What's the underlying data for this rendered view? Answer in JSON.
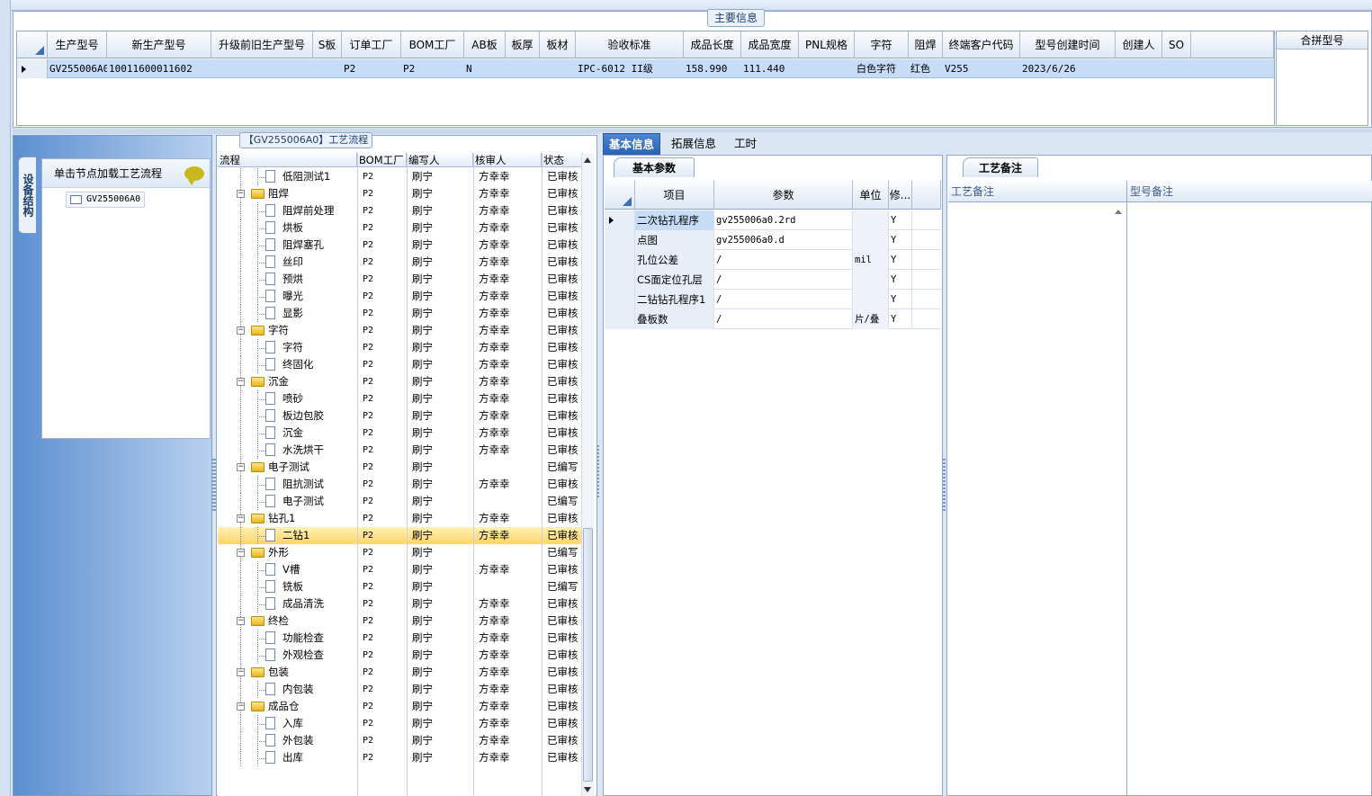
{
  "main_info": {
    "group_title": "主要信息",
    "columns": [
      "生产型号",
      "新生产型号",
      "升级前旧生产型号",
      "S板",
      "订单工厂",
      "BOM工厂",
      "AB板",
      "板厚",
      "板材",
      "验收标准",
      "成品长度",
      "成品宽度",
      "PNL规格",
      "字符",
      "阻焊",
      "终端客户代码",
      "型号创建时间",
      "创建人",
      "SO"
    ],
    "row": [
      "GV255006A0",
      "10011600011602",
      "",
      "",
      "P2",
      "P2",
      "N",
      "",
      "",
      "IPC-6012 II级",
      "158.990",
      "111.440",
      "",
      "白色字符",
      "红色",
      "V255",
      "2023/6/26",
      "",
      ""
    ],
    "merge_label": "合拼型号"
  },
  "left_panel": {
    "vertical_tab": "设备结构",
    "head_label": "单击节点加载工艺流程",
    "node_label": "GV255006A0"
  },
  "process": {
    "title": "【GV255006A0】工艺流程",
    "headers": [
      "流程",
      "BOM工厂",
      "编写人",
      "核审人",
      "状态"
    ],
    "rows": [
      {
        "name": "低阻测试1",
        "level": 1,
        "type": "doc",
        "bom": "P2",
        "writer": "刷宁",
        "reviewer": "方幸幸",
        "status": "已审核",
        "selected": false
      },
      {
        "name": "阻焊",
        "level": 0,
        "type": "folder",
        "bom": "P2",
        "writer": "刷宁",
        "reviewer": "方幸幸",
        "status": "已审核",
        "selected": false
      },
      {
        "name": "阻焊前处理",
        "level": 1,
        "type": "doc",
        "bom": "P2",
        "writer": "刷宁",
        "reviewer": "方幸幸",
        "status": "已审核",
        "selected": false
      },
      {
        "name": "烘板",
        "level": 1,
        "type": "doc",
        "bom": "P2",
        "writer": "刷宁",
        "reviewer": "方幸幸",
        "status": "已审核",
        "selected": false
      },
      {
        "name": "阻焊塞孔",
        "level": 1,
        "type": "doc",
        "bom": "P2",
        "writer": "刷宁",
        "reviewer": "方幸幸",
        "status": "已审核",
        "selected": false
      },
      {
        "name": "丝印",
        "level": 1,
        "type": "doc",
        "bom": "P2",
        "writer": "刷宁",
        "reviewer": "方幸幸",
        "status": "已审核",
        "selected": false
      },
      {
        "name": "预烘",
        "level": 1,
        "type": "doc",
        "bom": "P2",
        "writer": "刷宁",
        "reviewer": "方幸幸",
        "status": "已审核",
        "selected": false
      },
      {
        "name": "曝光",
        "level": 1,
        "type": "doc",
        "bom": "P2",
        "writer": "刷宁",
        "reviewer": "方幸幸",
        "status": "已审核",
        "selected": false
      },
      {
        "name": "显影",
        "level": 1,
        "type": "doc",
        "bom": "P2",
        "writer": "刷宁",
        "reviewer": "方幸幸",
        "status": "已审核",
        "selected": false
      },
      {
        "name": "字符",
        "level": 0,
        "type": "folder",
        "bom": "P2",
        "writer": "刷宁",
        "reviewer": "方幸幸",
        "status": "已审核",
        "selected": false
      },
      {
        "name": "字符",
        "level": 1,
        "type": "doc",
        "bom": "P2",
        "writer": "刷宁",
        "reviewer": "方幸幸",
        "status": "已审核",
        "selected": false
      },
      {
        "name": "终固化",
        "level": 1,
        "type": "doc",
        "bom": "P2",
        "writer": "刷宁",
        "reviewer": "方幸幸",
        "status": "已审核",
        "selected": false
      },
      {
        "name": "沉金",
        "level": 0,
        "type": "folder",
        "bom": "P2",
        "writer": "刷宁",
        "reviewer": "方幸幸",
        "status": "已审核",
        "selected": false
      },
      {
        "name": "喷砂",
        "level": 1,
        "type": "doc",
        "bom": "P2",
        "writer": "刷宁",
        "reviewer": "方幸幸",
        "status": "已审核",
        "selected": false
      },
      {
        "name": "板边包胶",
        "level": 1,
        "type": "doc",
        "bom": "P2",
        "writer": "刷宁",
        "reviewer": "方幸幸",
        "status": "已审核",
        "selected": false
      },
      {
        "name": "沉金",
        "level": 1,
        "type": "doc",
        "bom": "P2",
        "writer": "刷宁",
        "reviewer": "方幸幸",
        "status": "已审核",
        "selected": false
      },
      {
        "name": "水洗烘干",
        "level": 1,
        "type": "doc",
        "bom": "P2",
        "writer": "刷宁",
        "reviewer": "方幸幸",
        "status": "已审核",
        "selected": false
      },
      {
        "name": "电子测试",
        "level": 0,
        "type": "folder",
        "bom": "P2",
        "writer": "刷宁",
        "reviewer": "",
        "status": "已编写",
        "selected": false
      },
      {
        "name": "阻抗测试",
        "level": 1,
        "type": "doc",
        "bom": "P2",
        "writer": "刷宁",
        "reviewer": "方幸幸",
        "status": "已审核",
        "selected": false
      },
      {
        "name": "电子测试",
        "level": 1,
        "type": "doc",
        "bom": "P2",
        "writer": "刷宁",
        "reviewer": "",
        "status": "已编写",
        "selected": false
      },
      {
        "name": "钻孔1",
        "level": 0,
        "type": "folder",
        "bom": "P2",
        "writer": "刷宁",
        "reviewer": "方幸幸",
        "status": "已审核",
        "selected": false
      },
      {
        "name": "二钻1",
        "level": 1,
        "type": "doc",
        "bom": "P2",
        "writer": "刷宁",
        "reviewer": "方幸幸",
        "status": "已审核",
        "selected": true
      },
      {
        "name": "外形",
        "level": 0,
        "type": "folder",
        "bom": "P2",
        "writer": "刷宁",
        "reviewer": "",
        "status": "已编写",
        "selected": false
      },
      {
        "name": "V槽",
        "level": 1,
        "type": "doc",
        "bom": "P2",
        "writer": "刷宁",
        "reviewer": "方幸幸",
        "status": "已审核",
        "selected": false
      },
      {
        "name": "铣板",
        "level": 1,
        "type": "doc",
        "bom": "P2",
        "writer": "刷宁",
        "reviewer": "",
        "status": "已编写",
        "selected": false
      },
      {
        "name": "成品清洗",
        "level": 1,
        "type": "doc",
        "bom": "P2",
        "writer": "刷宁",
        "reviewer": "方幸幸",
        "status": "已审核",
        "selected": false
      },
      {
        "name": "终检",
        "level": 0,
        "type": "folder",
        "bom": "P2",
        "writer": "刷宁",
        "reviewer": "方幸幸",
        "status": "已审核",
        "selected": false
      },
      {
        "name": "功能检查",
        "level": 1,
        "type": "doc",
        "bom": "P2",
        "writer": "刷宁",
        "reviewer": "方幸幸",
        "status": "已审核",
        "selected": false
      },
      {
        "name": "外观检查",
        "level": 1,
        "type": "doc",
        "bom": "P2",
        "writer": "刷宁",
        "reviewer": "方幸幸",
        "status": "已审核",
        "selected": false
      },
      {
        "name": "包装",
        "level": 0,
        "type": "folder",
        "bom": "P2",
        "writer": "刷宁",
        "reviewer": "方幸幸",
        "status": "已审核",
        "selected": false
      },
      {
        "name": "内包装",
        "level": 1,
        "type": "doc",
        "bom": "P2",
        "writer": "刷宁",
        "reviewer": "方幸幸",
        "status": "已审核",
        "selected": false
      },
      {
        "name": "成品仓",
        "level": 0,
        "type": "folder",
        "bom": "P2",
        "writer": "刷宁",
        "reviewer": "方幸幸",
        "status": "已审核",
        "selected": false
      },
      {
        "name": "入库",
        "level": 1,
        "type": "doc",
        "bom": "P2",
        "writer": "刷宁",
        "reviewer": "方幸幸",
        "status": "已审核",
        "selected": false
      },
      {
        "name": "外包装",
        "level": 1,
        "type": "doc",
        "bom": "P2",
        "writer": "刷宁",
        "reviewer": "方幸幸",
        "status": "已审核",
        "selected": false
      },
      {
        "name": "出库",
        "level": 1,
        "type": "doc",
        "bom": "P2",
        "writer": "刷宁",
        "reviewer": "方幸幸",
        "status": "已审核",
        "selected": false
      }
    ]
  },
  "tabs": [
    "基本信息",
    "拓展信息",
    "工时"
  ],
  "basic_params": {
    "tab_label": "基本参数",
    "headers": [
      "项目",
      "参数",
      "单位",
      "修..."
    ],
    "rows": [
      {
        "item": "二次钻孔程序",
        "param": "gv255006a0.2rd",
        "unit": "",
        "mod": "Y"
      },
      {
        "item": "点图",
        "param": "gv255006a0.d",
        "unit": "",
        "mod": "Y"
      },
      {
        "item": "孔位公差",
        "param": "/",
        "unit": "mil",
        "mod": "Y"
      },
      {
        "item": "CS面定位孔层",
        "param": "/",
        "unit": "",
        "mod": "Y"
      },
      {
        "item": "二钻钻孔程序1",
        "param": "/",
        "unit": "",
        "mod": "Y"
      },
      {
        "item": "叠板数",
        "param": "/",
        "unit": "片/叠",
        "mod": "Y"
      }
    ]
  },
  "notes": {
    "tab_label": "工艺备注",
    "col1": "工艺备注",
    "col2": "型号备注"
  }
}
